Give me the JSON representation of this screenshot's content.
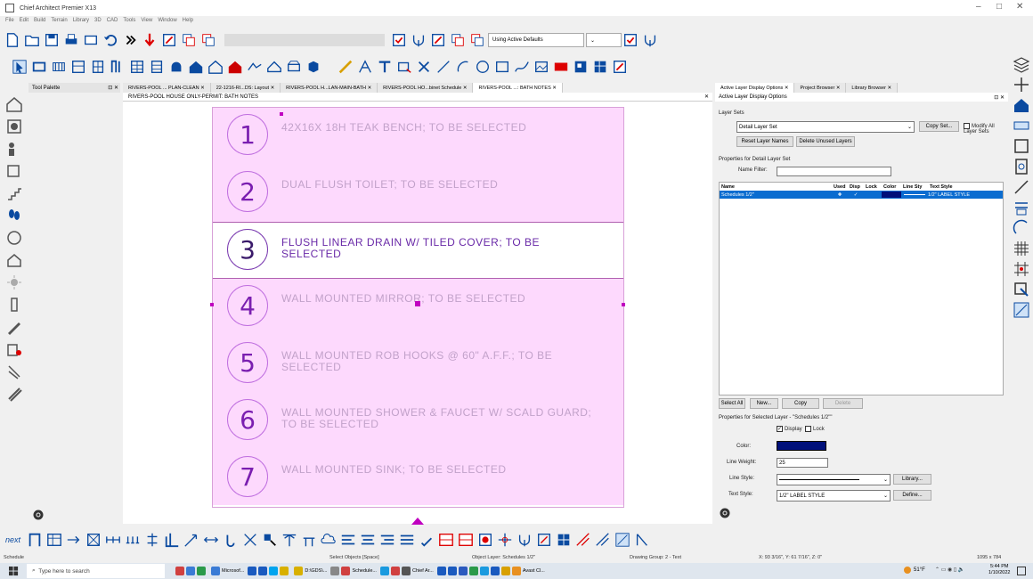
{
  "window": {
    "title": "Chief Architect Premier X13",
    "minimize": "–",
    "maximize": "□",
    "close": "✕"
  },
  "menu": [
    "File",
    "Edit",
    "Build",
    "Terrain",
    "Library",
    "3D",
    "CAD",
    "Tools",
    "View",
    "Window",
    "Help"
  ],
  "toolbar": {
    "defaults_dropdown": "Using Active Defaults"
  },
  "tool_palette": {
    "title": "Tool Palette",
    "controls": "⊡ ✕"
  },
  "tabs": [
    {
      "label": "RIVERS-POOL ... PLAN-CLEAN",
      "active": false
    },
    {
      "label": "22-1216-RI...DS: Layout",
      "active": false
    },
    {
      "label": "RIVERS-POOL H...LAN-MAIN-BATH",
      "active": false
    },
    {
      "label": "RIVERS-POOL HO...binet Schedule",
      "active": false
    },
    {
      "label": "RIVERS-POOL ...: BATH NOTES",
      "active": true
    }
  ],
  "tab_close": "✕",
  "view": {
    "title": "RIVERS-POOL HOUSE ONLY-PERMIT: BATH NOTES",
    "close": "✕"
  },
  "notes": [
    {
      "number": "1",
      "text": "42X16X 18H TEAK BENCH; TO BE SELECTED"
    },
    {
      "number": "2",
      "text": "DUAL FLUSH TOILET; TO BE SELECTED"
    },
    {
      "number": "3",
      "text": "FLUSH LINEAR DRAIN W/ TILED COVER; TO BE SELECTED"
    },
    {
      "number": "4",
      "text": "WALL MOUNTED MIRROR; TO BE SELECTED"
    },
    {
      "number": "5",
      "text": "WALL MOUNTED ROB HOOKS @ 60\" A.F.F.; TO BE SELECTED"
    },
    {
      "number": "6",
      "text": "WALL MOUNTED SHOWER & FAUCET W/ SCALD GUARD; TO BE SELECTED"
    },
    {
      "number": "7",
      "text": "WALL MOUNTED SINK; TO BE SELECTED"
    }
  ],
  "active_note_index": 2,
  "right_tabs": [
    {
      "label": "Active Layer Display Options",
      "active": true
    },
    {
      "label": "Project Browser",
      "active": false
    },
    {
      "label": "Library Browser",
      "active": false
    }
  ],
  "layer_panel": {
    "title": "Active Layer Display Options",
    "controls": "⊡ ✕",
    "layer_sets_label": "Layer Sets",
    "layer_set_value": "Detail Layer Set",
    "copy_set": "Copy Set...",
    "modify_all": "Modify All Layer Sets",
    "reset_names": "Reset Layer Names",
    "delete_unused": "Delete Unused Layers",
    "properties_label": "Properties for Detail Layer Set",
    "name_filter_label": "Name Filter:",
    "name_filter_value": "",
    "columns": {
      "name": "Name",
      "used": "Used",
      "disp": "Disp",
      "lock": "Lock",
      "color": "Color",
      "line_sty": "Line Sty",
      "text_style": "Text Style"
    },
    "row": {
      "name": "Schedules 1/2\"",
      "used": "✚",
      "disp": "✓",
      "color_hex": "#00107a",
      "text_style": "1/2\" LABEL STYLE"
    },
    "select_all": "Select All",
    "new": "New...",
    "copy": "Copy",
    "delete": "Delete",
    "selected_props_label": "Properties for Selected Layer - \"Schedules 1/2\"\"",
    "display_label": "Display",
    "lock_label": "Lock",
    "color_label": "Color:",
    "line_weight_label": "Line Weight:",
    "line_weight_value": "25",
    "line_style_label": "Line Style:",
    "library": "Library...",
    "text_style_label": "Text Style:",
    "text_style_value": "1/2\" LABEL STYLE",
    "define": "Define..."
  },
  "status": {
    "left": "Schedule",
    "hint": "Select Objects [Space]",
    "object_layer": "Object Layer: Schedules 1/2\"",
    "drawing_group": "Drawing Group: 2 - Text",
    "coords": "X: 93 3/16\", Y: 61 7/16\", Z: 0\"",
    "size": "1095 x 784"
  },
  "taskbar": {
    "search": "Type here to search",
    "items": [
      "Microsof...",
      "D:\\GDS\\...",
      "Schedule...",
      "Chief Ar...",
      "Avast Cl..."
    ],
    "weather": "51°F",
    "time": "5:44 PM",
    "date": "1/10/2022"
  },
  "next_label": "next",
  "colors": {
    "accent": "#0a6cd0",
    "note_bg": "#fdd9fd",
    "note_number": "#7a1eb0",
    "note_text": "#c2a2ca"
  }
}
